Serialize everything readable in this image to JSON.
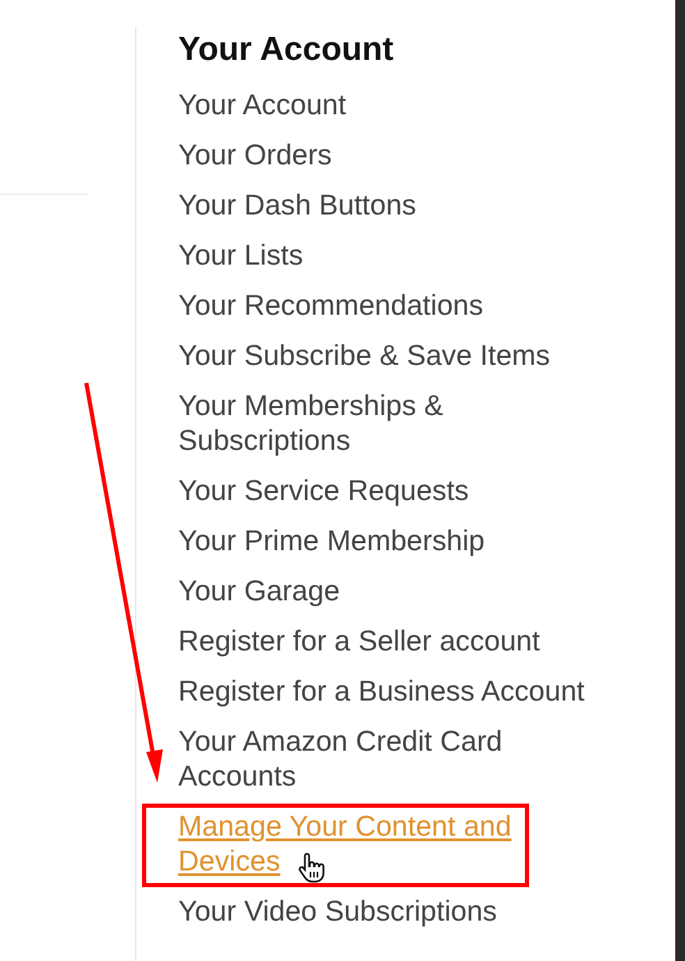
{
  "menu": {
    "title": "Your Account",
    "items": [
      {
        "label": "Your Account",
        "kind": "text",
        "highlighted": false
      },
      {
        "label": "Your Orders",
        "kind": "text",
        "highlighted": false
      },
      {
        "label": "Your Dash Buttons",
        "kind": "text",
        "highlighted": false
      },
      {
        "label": "Your Lists",
        "kind": "text",
        "highlighted": false
      },
      {
        "label": "Your Recommendations",
        "kind": "text",
        "highlighted": false
      },
      {
        "label": "Your Subscribe & Save Items",
        "kind": "text",
        "highlighted": false
      },
      {
        "label": "Your Memberships & Subscriptions",
        "kind": "text",
        "highlighted": false
      },
      {
        "label": "Your Service Requests",
        "kind": "text",
        "highlighted": false
      },
      {
        "label": "Your Prime Membership",
        "kind": "text",
        "highlighted": false
      },
      {
        "label": "Your Garage",
        "kind": "text",
        "highlighted": false
      },
      {
        "label": "Register for a Seller account",
        "kind": "text",
        "highlighted": false
      },
      {
        "label": "Register for a Business Account",
        "kind": "text",
        "highlighted": false
      },
      {
        "label": "Your Amazon Credit Card Accounts",
        "kind": "text",
        "highlighted": false
      },
      {
        "label": "Manage Your Content and Devices",
        "kind": "link",
        "highlighted": true
      },
      {
        "label": "Your Video Subscriptions",
        "kind": "text",
        "highlighted": false
      }
    ]
  }
}
